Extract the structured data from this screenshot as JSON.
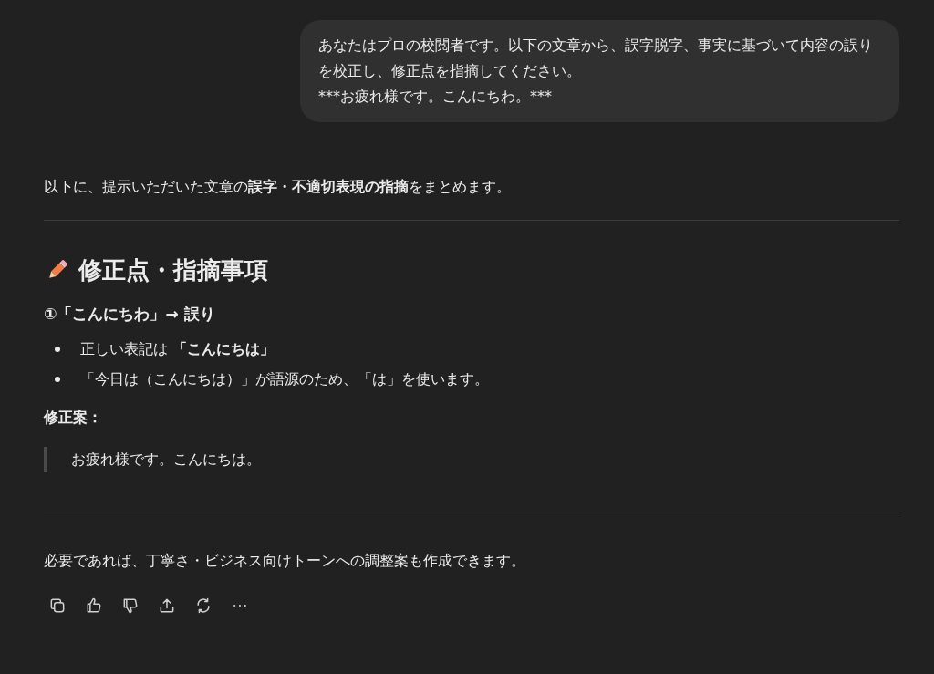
{
  "user_message": {
    "paragraphs": [
      "あなたはプロの校閲者です。以下の文章から、誤字脱字、事実に基づいて内容の誤りを校正し、修正点を指摘してください。",
      "***お疲れ様です。こんにちわ。***"
    ]
  },
  "response": {
    "intro": "以下に、提示いただいた文章の**誤字・不適切表現の指摘**をまとめます。",
    "heading": "修正点・指摘事項",
    "subheading": "①「こんにちわ」→ 誤り",
    "bullets": [
      "正しい表記は **「こんにちは」**",
      "「今日は（こんにちは）」が語源のため、「は」を使います。"
    ],
    "proposal_label": "修正案：",
    "quote": "お疲れ様です。こんにちは。",
    "closing": "必要であれば、丁寧さ・ビジネス向けトーンへの調整案も作成できます。"
  },
  "actions": [
    {
      "kind": "copy"
    },
    {
      "kind": "like"
    },
    {
      "kind": "dislike"
    },
    {
      "kind": "share"
    },
    {
      "kind": "regenerate"
    },
    {
      "kind": "more"
    }
  ]
}
